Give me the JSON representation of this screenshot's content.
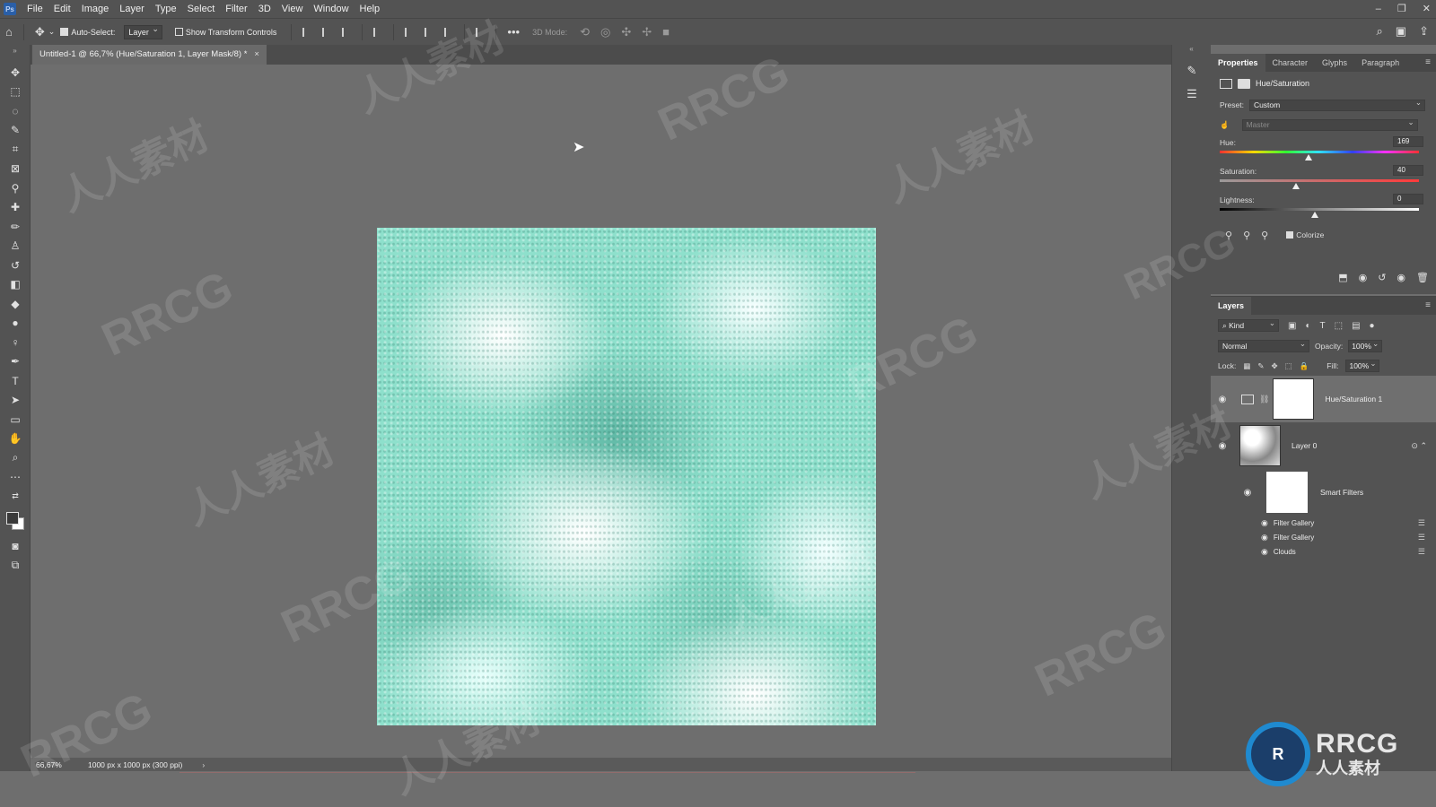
{
  "app": {
    "logo": "Ps"
  },
  "menu": [
    "File",
    "Edit",
    "Image",
    "Layer",
    "Type",
    "Select",
    "Filter",
    "3D",
    "View",
    "Window",
    "Help"
  ],
  "window_controls": [
    "–",
    "❐",
    "✕"
  ],
  "options_bar": {
    "auto_select_label": "Auto-Select:",
    "auto_select_target": "Layer",
    "show_transform_label": "Show Transform Controls",
    "more": "•••",
    "mode_3d_label": "3D Mode:"
  },
  "document": {
    "tab_title": "Untitled-1 @ 66,7% (Hue/Saturation 1, Layer Mask/8) *",
    "close": "×"
  },
  "status": {
    "zoom": "66,67%",
    "doc_size": "1000 px x 1000 px (300 ppi)",
    "arrow": "›"
  },
  "properties": {
    "tabs": [
      "Properties",
      "Character",
      "Glyphs",
      "Paragraph"
    ],
    "title": "Hue/Saturation",
    "preset_label": "Preset:",
    "preset_value": "Custom",
    "channel": "Master",
    "hue_label": "Hue:",
    "hue_value": "169",
    "saturation_label": "Saturation:",
    "saturation_value": "40",
    "lightness_label": "Lightness:",
    "lightness_value": "0",
    "colorize_label": "Colorize",
    "colorize_checked": true
  },
  "layers": {
    "title": "Layers",
    "kind_label": "Kind",
    "blend_mode": "Normal",
    "opacity_label": "Opacity:",
    "opacity_value": "100%",
    "lock_label": "Lock:",
    "fill_label": "Fill:",
    "fill_value": "100%",
    "items": [
      {
        "name": "Hue/Saturation 1"
      },
      {
        "name": "Layer 0"
      },
      {
        "name": "Smart Filters"
      }
    ],
    "filters": [
      "Filter Gallery",
      "Filter Gallery",
      "Clouds"
    ]
  },
  "watermark": {
    "text_en": "RRCG",
    "text_cn": "人人素材"
  },
  "colors": {
    "ui_dark": "#535353",
    "canvas_bg": "#6e6e6e",
    "artwork_teal": "#8ee0cc"
  }
}
